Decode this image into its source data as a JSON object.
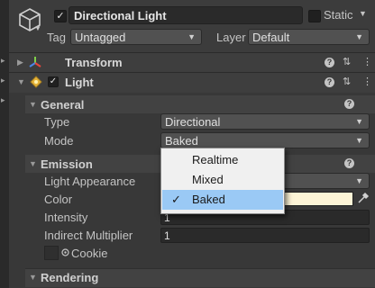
{
  "object": {
    "name": "Directional Light",
    "active": true,
    "static_label": "Static",
    "static": false,
    "tag_label": "Tag",
    "tag_value": "Untagged",
    "layer_label": "Layer",
    "layer_value": "Default"
  },
  "components": {
    "transform_title": "Transform",
    "light_title": "Light"
  },
  "general": {
    "title": "General",
    "type_label": "Type",
    "type_value": "Directional",
    "mode_label": "Mode",
    "mode_value": "Baked"
  },
  "mode_menu": {
    "options": [
      "Realtime",
      "Mixed",
      "Baked"
    ],
    "selected": "Baked"
  },
  "emission": {
    "title": "Emission",
    "light_appearance_label": "Light Appearance",
    "color_label": "Color",
    "color_value": "#fdf4d6",
    "intensity_label": "Intensity",
    "intensity_value": "1",
    "indirect_label": "Indirect Multiplier",
    "indirect_value": "1",
    "cookie_label": "Cookie"
  },
  "rendering": {
    "title": "Rendering"
  },
  "icons": {
    "help": "?",
    "presets": "⇅",
    "menu": "⋮",
    "check": "✓",
    "fold_open": "▼",
    "fold_closed": "▶",
    "dropdown": "▼"
  }
}
